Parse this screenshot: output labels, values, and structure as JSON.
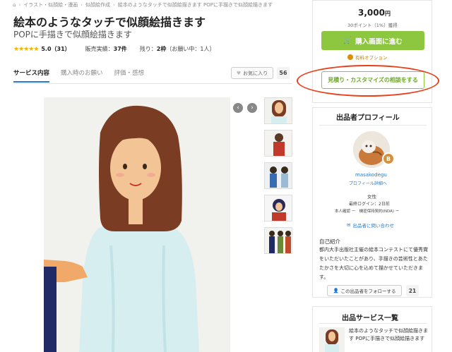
{
  "breadcrumb": {
    "items": [
      "イラスト・似顔絵・漫画",
      "似顔絵作成",
      "絵本のようなタッチで似顔絵描きます POPに手描きで似顔絵描きます"
    ]
  },
  "service": {
    "title": "絵本のようなタッチで似顔絵描きます",
    "subtitle": "POPに手描きで似顔絵描きます",
    "stars": "★★★★★",
    "rating": "5.0（31）",
    "sales_label": "販売実績：",
    "sales_value": "37件",
    "slots_label": "残り：",
    "slots_value": "2枠",
    "slots_note": "（お願い中：1人）"
  },
  "tabs": [
    {
      "label": "サービス内容",
      "active": true
    },
    {
      "label": "購入時のお願い",
      "active": false
    },
    {
      "label": "評価・感想",
      "active": false
    }
  ],
  "favorite": {
    "label": "お気に入り",
    "count": "56"
  },
  "gallery": {
    "prev": "‹",
    "next": "›"
  },
  "purchase": {
    "price": "3,000",
    "currency": "円",
    "points": "30ポイント（1%）獲得",
    "buy_label": "購入画面に進む",
    "paid_option": "有料オプション",
    "estimate_label": "見積り・カスタマイズの相談をする"
  },
  "profile": {
    "heading": "出品者プロフィール",
    "badge": "B",
    "username": "masakodegu",
    "detail_link": "プロフィール詳細へ",
    "gender": "女性",
    "last_login": "最終ログイン：2日前",
    "verification": "本人確認 ー　機密保持契約(NDA) ー",
    "contact": "出品者に問い合わせ",
    "intro_heading": "自己紹介",
    "intro_body": "都内大手出版社主催の絵本コンテストにて優秀賞をいただいたことがあり、手描きの芸術性とあたたかさを大切に心を込めて描かせていただきます。",
    "follow_label": "この出品者をフォローする",
    "follow_count": "21"
  },
  "services_list": {
    "heading": "出品サービス一覧",
    "item_text": "絵本のようなタッチで似顔絵描きます POPに手描きで似顔絵描きます"
  },
  "colors": {
    "accent_green": "#8dc63f",
    "link_blue": "#2a7ac8",
    "annotation_red": "#e8401c",
    "star_gold": "#f5b301"
  }
}
